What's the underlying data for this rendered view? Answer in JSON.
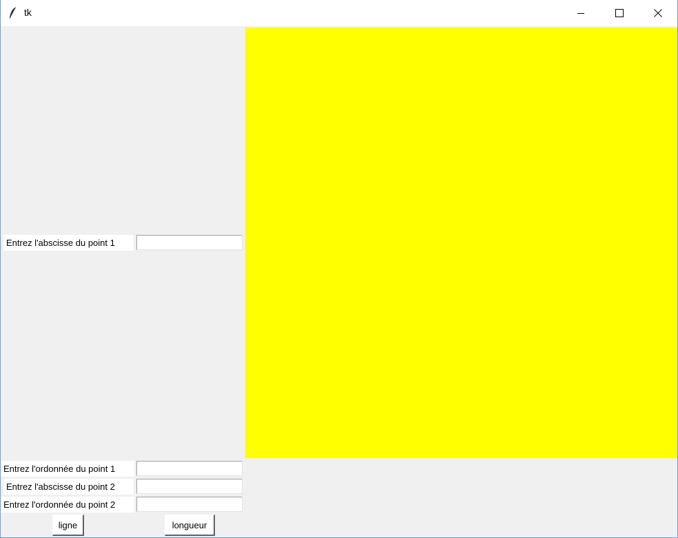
{
  "window": {
    "title": "tk",
    "controls": [
      "minimize",
      "maximize",
      "close"
    ]
  },
  "canvas": {
    "background": "#ffff00"
  },
  "form": {
    "x1_label": "Entrez l'abscisse du point 1",
    "y1_label": "Entrez l'ordonnée du point 1",
    "x2_label": "Entrez l'abscisse du point 2",
    "y2_label": "Entrez l'ordonnée du point 2",
    "x1_value": "",
    "y1_value": "",
    "x2_value": "",
    "y2_value": ""
  },
  "buttons": {
    "ligne": "ligne",
    "longueur": "longueur"
  }
}
